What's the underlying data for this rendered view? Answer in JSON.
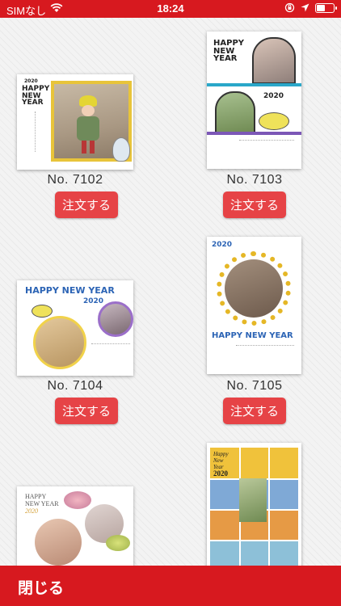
{
  "status_bar": {
    "carrier": "SIMなし",
    "time": "18:24"
  },
  "products": [
    {
      "number": "No. 7102",
      "order_label": "注文する",
      "greeting_lines": [
        "HAPPY",
        "NEW",
        "YEAR"
      ],
      "year": "2020"
    },
    {
      "number": "No. 7103",
      "order_label": "注文する",
      "greeting_lines": [
        "HAPPY",
        "NEW",
        "YEAR"
      ],
      "year": "2020"
    },
    {
      "number": "No. 7104",
      "order_label": "注文する",
      "greeting_lines": [
        "HAPPY NEW YEAR"
      ],
      "year": "2020"
    },
    {
      "number": "No. 7105",
      "order_label": "注文する",
      "greeting_lines": [
        "HAPPY NEW YEAR"
      ],
      "year": "2020"
    },
    {
      "greeting_lines": [
        "HAPPY",
        "NEW YEAR"
      ],
      "year": "2020"
    },
    {
      "greeting_lines": [
        "Happy",
        "New",
        "Year"
      ],
      "year": "2020"
    }
  ],
  "footer": {
    "close_label": "閉じる"
  }
}
